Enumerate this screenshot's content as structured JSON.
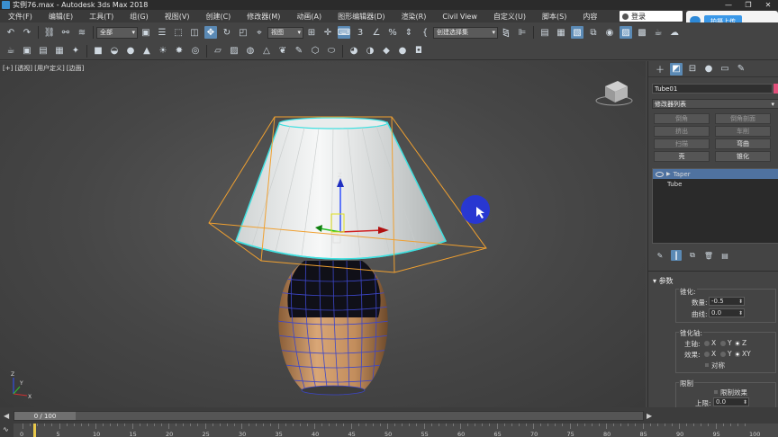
{
  "title": "实例76.max - Autodesk 3ds Max 2018",
  "window_controls": [
    "—",
    "❐",
    "✕"
  ],
  "menu": [
    "文件(F)",
    "编辑(E)",
    "工具(T)",
    "组(G)",
    "视图(V)",
    "创建(C)",
    "修改器(M)",
    "动画(A)",
    "图形编辑器(D)",
    "渲染(R)",
    "Civil View",
    "自定义(U)",
    "脚本(S)",
    "内容"
  ],
  "login_label": "登录",
  "upload_label": "拍摄上传",
  "toolbar": {
    "selection_filter": "全部",
    "ref_coord": "视图",
    "selection_set": "创建选择集"
  },
  "viewport": {
    "label": "[+] [透视] [用户定义] [边面]",
    "axis_labels": [
      "X",
      "Y",
      "Z"
    ]
  },
  "command_panel": {
    "object_name": "Tube01",
    "modifier_list": "修改器列表",
    "modifier_buttons": [
      {
        "label": "倒角",
        "enabled": false
      },
      {
        "label": "倒角剖面",
        "enabled": false
      },
      {
        "label": "挤出",
        "enabled": false
      },
      {
        "label": "车削",
        "enabled": false
      },
      {
        "label": "扫描",
        "enabled": false
      },
      {
        "label": "弯曲",
        "enabled": true
      },
      {
        "label": "壳",
        "enabled": true
      },
      {
        "label": "锥化",
        "enabled": true
      }
    ],
    "stack": [
      {
        "label": "Taper",
        "selected": true
      },
      {
        "label": "Tube",
        "selected": false
      }
    ],
    "rollout_title": "参数",
    "taper_group": "锥化:",
    "amount_label": "数量:",
    "amount_value": "-0.5",
    "curve_label": "曲线:",
    "curve_value": "0.0",
    "axis_group": "锥化轴:",
    "primary_label": "主轴:",
    "effect_label": "效果:",
    "symmetry_label": "对称",
    "primary_options": [
      "X",
      "Y",
      "Z"
    ],
    "effect_options": [
      "X",
      "Y",
      "XY"
    ],
    "limit_group": "限制",
    "limit_effect_label": "限制效果",
    "upper_label": "上限:",
    "upper_value": "0.0"
  },
  "timeline": {
    "frame_display": "0 / 100",
    "ticks": [
      "0",
      "5",
      "10",
      "15",
      "20",
      "25",
      "30",
      "35",
      "40",
      "45",
      "50",
      "55",
      "60",
      "65",
      "70",
      "75",
      "80",
      "85",
      "90",
      "95",
      "100"
    ]
  }
}
